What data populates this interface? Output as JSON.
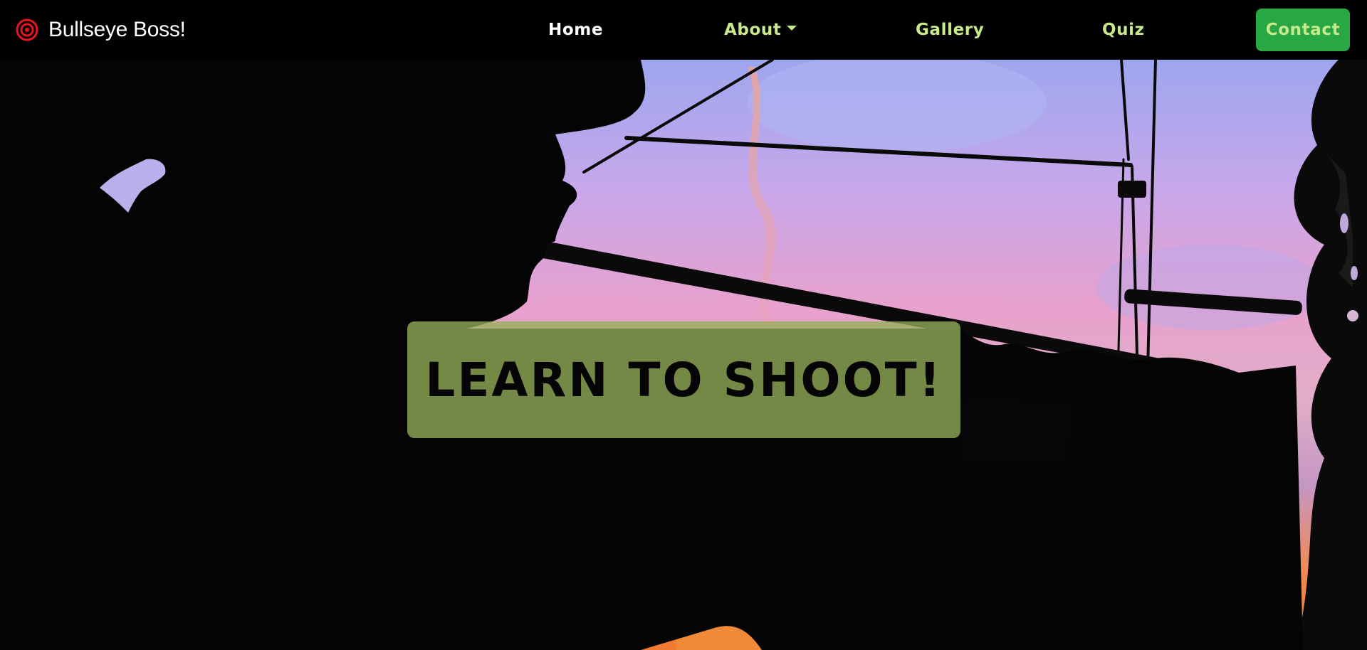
{
  "brand": {
    "name": "Bullseye Boss!",
    "icon": "bullseye-icon",
    "icon_color": "#e8141e"
  },
  "nav": {
    "home": "Home",
    "about": "About",
    "gallery": "Gallery",
    "quiz": "Quiz",
    "contact": "Contact"
  },
  "colors": {
    "nav_active": "#ffffff",
    "nav_link": "#c7ea8a",
    "contact_button": "#28a745",
    "banner": "#96af5a"
  },
  "hero": {
    "title": "LEARN TO SHOOT!",
    "image": "archer-silhouette-at-sunset"
  }
}
